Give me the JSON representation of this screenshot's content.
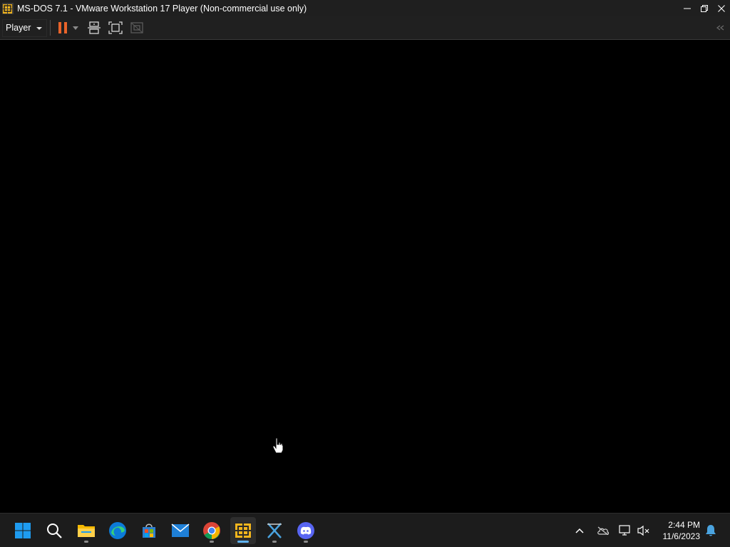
{
  "window": {
    "title": "MS-DOS 7.1 - VMware Workstation 17 Player (Non-commercial use only)"
  },
  "toolbar": {
    "player_menu_label": "Player"
  },
  "taskbar": {
    "apps": [
      {
        "name": "start",
        "icon": "windows-logo-icon"
      },
      {
        "name": "search",
        "icon": "search-icon"
      },
      {
        "name": "file-explorer",
        "icon": "folder-icon"
      },
      {
        "name": "edge",
        "icon": "edge-icon"
      },
      {
        "name": "microsoft-store",
        "icon": "store-icon"
      },
      {
        "name": "mail",
        "icon": "mail-icon"
      },
      {
        "name": "chrome",
        "icon": "chrome-icon"
      },
      {
        "name": "vmware-player",
        "icon": "vmware-icon",
        "active": true
      },
      {
        "name": "xming",
        "icon": "x-icon"
      },
      {
        "name": "discord",
        "icon": "discord-icon"
      }
    ],
    "clock": {
      "time": "2:44 PM",
      "date": "11/6/2023"
    }
  },
  "colors": {
    "titlebar_bg": "#1f1f1f",
    "toolbar_bg": "#202020",
    "vm_screen_bg": "#000000",
    "taskbar_bg": "#1c1c1c",
    "pause_orange": "#e8632a",
    "active_indicator": "#5fb2f2"
  }
}
